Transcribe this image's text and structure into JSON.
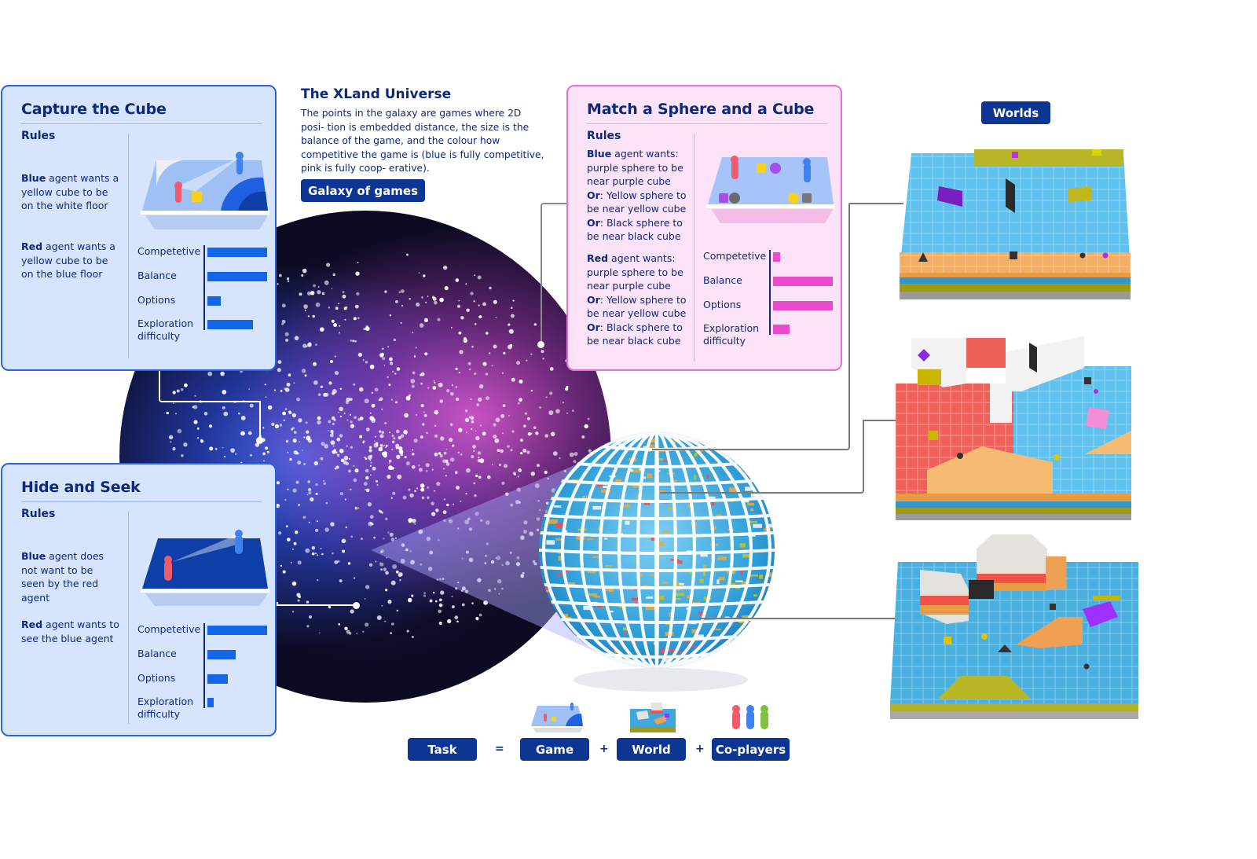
{
  "universe": {
    "title": "The XLand Universe",
    "description": "The points in the galaxy are games where 2D posi- tion is embedded distance, the size is the balance of the game, and the colour how competitive the game is (blue is fully competitive, pink is fully coop- erative).",
    "galaxy_button": "Galaxy of games"
  },
  "worlds_button": "Worlds",
  "stat_labels": {
    "competetive": "Competetive",
    "balance": "Balance",
    "options": "Options",
    "exploration_1": "Exploration",
    "exploration_2": "difficulty"
  },
  "cards": {
    "capture": {
      "title": "Capture the Cube",
      "rules_label": "Rules",
      "rules": [
        {
          "agent": "Blue",
          "text": " agent wants a yellow cube to be on the white floor"
        },
        {
          "agent": "Red",
          "text": " agent wants a yellow cube to be on the blue floor"
        }
      ],
      "stats": {
        "competetive": 1.0,
        "balance": 1.0,
        "options": 0.22,
        "exploration_difficulty": 0.76
      }
    },
    "hide": {
      "title": "Hide and Seek",
      "rules_label": "Rules",
      "rules": [
        {
          "agent": "Blue",
          "text": " agent does not want to be seen by the red agent"
        },
        {
          "agent": "Red",
          "text": " agent wants to see the blue agent"
        }
      ],
      "stats": {
        "competetive": 1.0,
        "balance": 0.47,
        "options": 0.34,
        "exploration_difficulty": 0.1
      }
    },
    "match": {
      "title": "Match a Sphere and a Cube",
      "rules_label": "Rules",
      "blue_rules": {
        "agent": "Blue",
        "lead": " agent wants:",
        "lines": [
          "purple sphere to be",
          "near purple cube"
        ],
        "or_label": "Or",
        "alts": [
          ": Yellow sphere to",
          "be near yellow cube",
          ": Black sphere to",
          "be near black cube"
        ]
      },
      "red_rules": {
        "agent": "Red",
        "lead": " agent wants:",
        "lines": [
          "purple sphere to be",
          "near purple cube"
        ],
        "or_label": "Or",
        "alts": [
          ": Yellow sphere to",
          "be near yellow cube",
          ": Black sphere to",
          "be near black cube"
        ]
      },
      "stats": {
        "competetive": 0.12,
        "balance": 1.0,
        "options": 1.0,
        "exploration_difficulty": 0.27
      }
    }
  },
  "equation": {
    "task": "Task",
    "equals": "=",
    "game": "Game",
    "plus1": "+",
    "world": "World",
    "plus2": "+",
    "coplayers": "Co-players"
  },
  "colors": {
    "navy": "#0d3594",
    "blue_card_bg": "#d6e4fd",
    "pink_card_bg": "#fde3f8",
    "blue_bar": "#1565e8",
    "pink_bar": "#e84bcb"
  }
}
